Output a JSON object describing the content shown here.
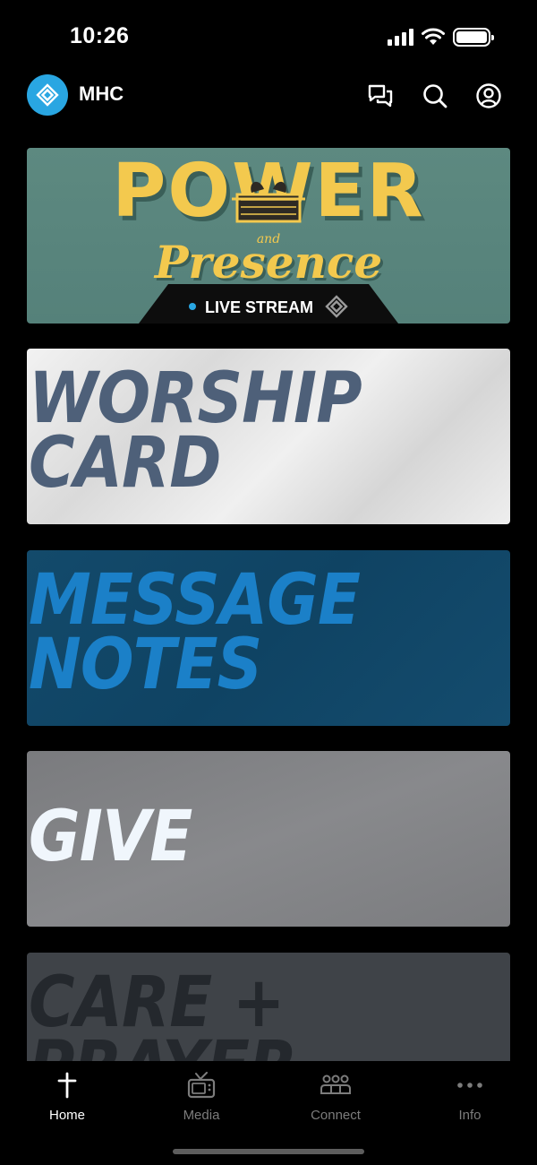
{
  "status_bar": {
    "time": "10:26"
  },
  "header": {
    "app_title": "MHC",
    "icons": [
      "chat-bubbles-icon",
      "search-icon",
      "profile-icon"
    ]
  },
  "cards": {
    "power": {
      "title": "POWER",
      "and": "and",
      "subtitle": "Presence",
      "live_label": "LIVE STREAM"
    },
    "worship": {
      "line1": "WORSHIP",
      "line2": "CARD"
    },
    "message": {
      "line1": "MESSAGE",
      "line2": "NOTES"
    },
    "give": {
      "line1": "GIVE"
    },
    "care": {
      "line1": "CARE +",
      "line2": "PRAYER"
    }
  },
  "colors": {
    "accent": "#29a6e2",
    "power_bg": "#5d8980",
    "power_gold": "#f3c94e",
    "worship_text": "#4e6079",
    "message_bg": "#134a6b",
    "message_text": "#1b80c8"
  },
  "tabs": [
    {
      "label": "Home",
      "icon": "cross-icon",
      "active": true
    },
    {
      "label": "Media",
      "icon": "tv-icon",
      "active": false
    },
    {
      "label": "Connect",
      "icon": "group-icon",
      "active": false
    },
    {
      "label": "Info",
      "icon": "more-dots-icon",
      "active": false
    }
  ]
}
